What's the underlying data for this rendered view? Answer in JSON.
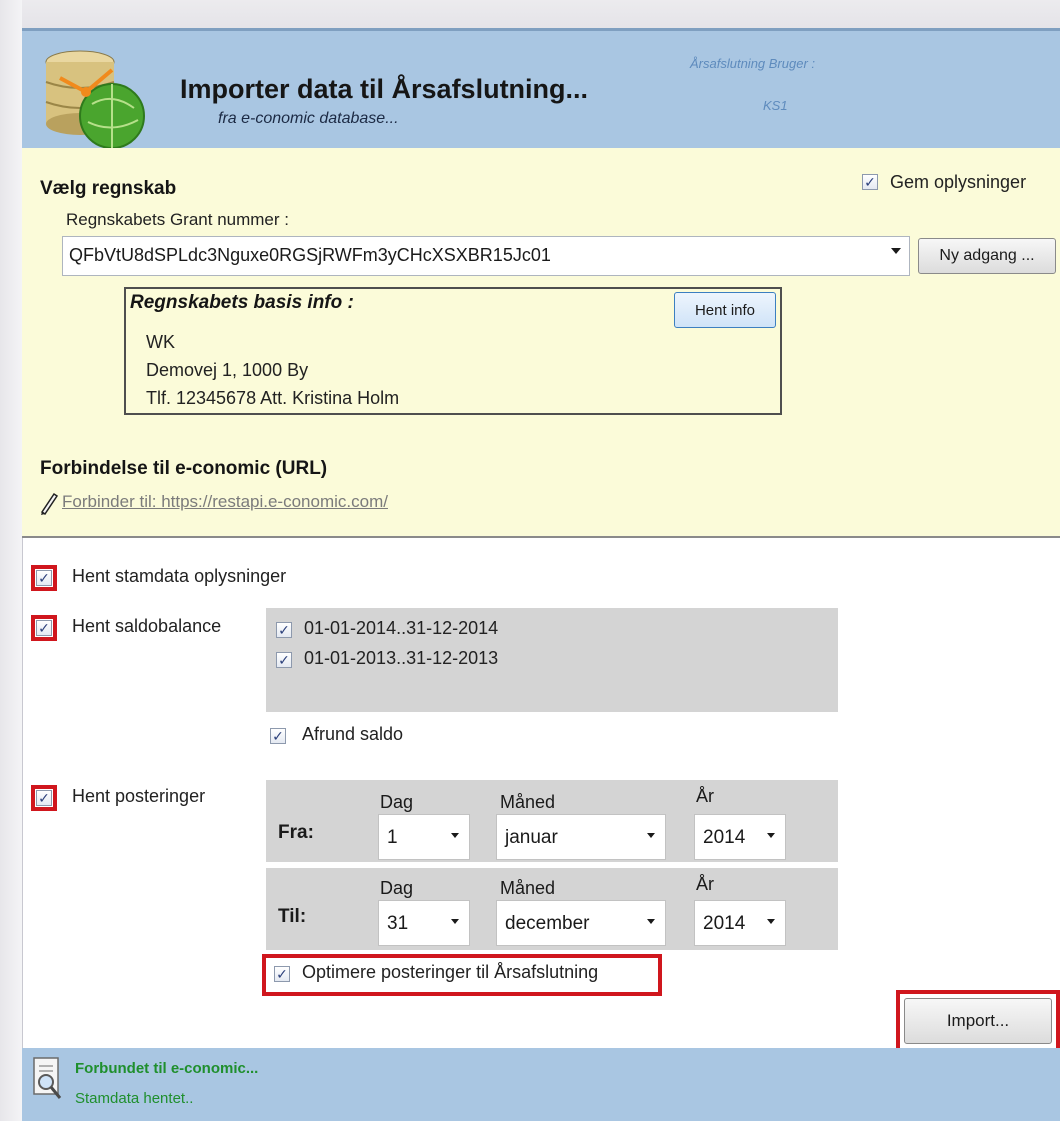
{
  "header": {
    "title": "Importer data til Årsafslutning...",
    "subtitle": "fra e-conomic database...",
    "user_label": "Årsafslutning Bruger :",
    "user_value": "KS1"
  },
  "account": {
    "section_label": "Vælg regnskab",
    "save_checkbox_label": "Gem oplysninger",
    "save_checked": true,
    "grant_label": "Regnskabets Grant nummer :",
    "grant_value": "QFbVtU8dSPLdc3Nguxe0RGSjRWFm3yCHcXSXBR15Jc01",
    "new_access_button": "Ny adgang ...",
    "basis_title": "Regnskabets basis info :",
    "fetch_info_button": "Hent info",
    "basis_lines": [
      "WK",
      "Demovej 1, 1000 By",
      "Tlf. 12345678   Att. Kristina Holm"
    ]
  },
  "connection": {
    "title": "Forbindelse til e-conomic (URL)",
    "link_text": "Forbinder til: https://restapi.e-conomic.com/",
    "icon": "pencil-icon"
  },
  "options": {
    "stamdata_label": "Hent stamdata oplysninger",
    "saldobalance_label": "Hent saldobalance",
    "periods": [
      "01-01-2014..31-12-2014",
      "01-01-2013..31-12-2013"
    ],
    "round_label": "Afrund saldo",
    "posteringer_label": "Hent posteringer",
    "optimize_label": "Optimere posteringer til Årsafslutning"
  },
  "date_range": {
    "col_day": "Dag",
    "col_month": "Måned",
    "col_year": "År",
    "from": {
      "label": "Fra:",
      "day": "1",
      "month": "januar",
      "year": "2014"
    },
    "to": {
      "label": "Til:",
      "day": "31",
      "month": "december",
      "year": "2014"
    }
  },
  "actions": {
    "import_button": "Import..."
  },
  "status": {
    "line1": "Forbundet til e-conomic...",
    "line2": "Stamdata hentet.."
  },
  "colors": {
    "header_bg": "#a9c6e2",
    "panel_bg": "#fbfbd9",
    "highlight_red": "#d0161d",
    "status_green": "#1f8f2d"
  }
}
